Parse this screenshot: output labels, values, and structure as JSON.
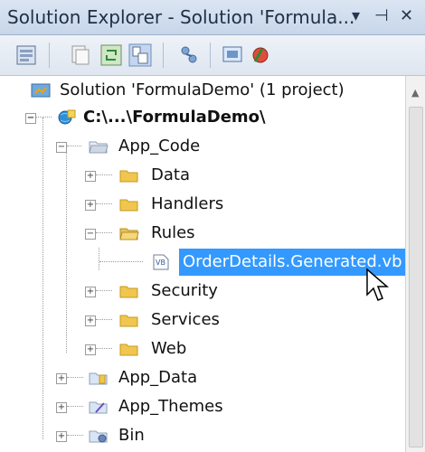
{
  "window": {
    "title": "Solution Explorer - Solution 'Formula...",
    "buttons": [
      "▾",
      "⊣",
      "✕"
    ]
  },
  "toolbar": {
    "icons": [
      "properties-icon",
      "show-all-files-icon",
      "refresh-icon",
      "nest-related-icon",
      "view-class-diagram-icon",
      "copy-website-icon",
      "aspnet-config-icon"
    ]
  },
  "tree": {
    "solution": "Solution 'FormulaDemo' (1 project)",
    "project": "C:\\...\\FormulaDemo\\",
    "app_code": "App_Code",
    "data": "Data",
    "handlers": "Handlers",
    "rules": "Rules",
    "generated_file": "OrderDetails.Generated.vb",
    "security": "Security",
    "services": "Services",
    "web": "Web",
    "app_data": "App_Data",
    "app_themes": "App_Themes",
    "bin": "Bin"
  },
  "colors": {
    "selection": "#3399ff",
    "folder": "#f1c64f"
  }
}
